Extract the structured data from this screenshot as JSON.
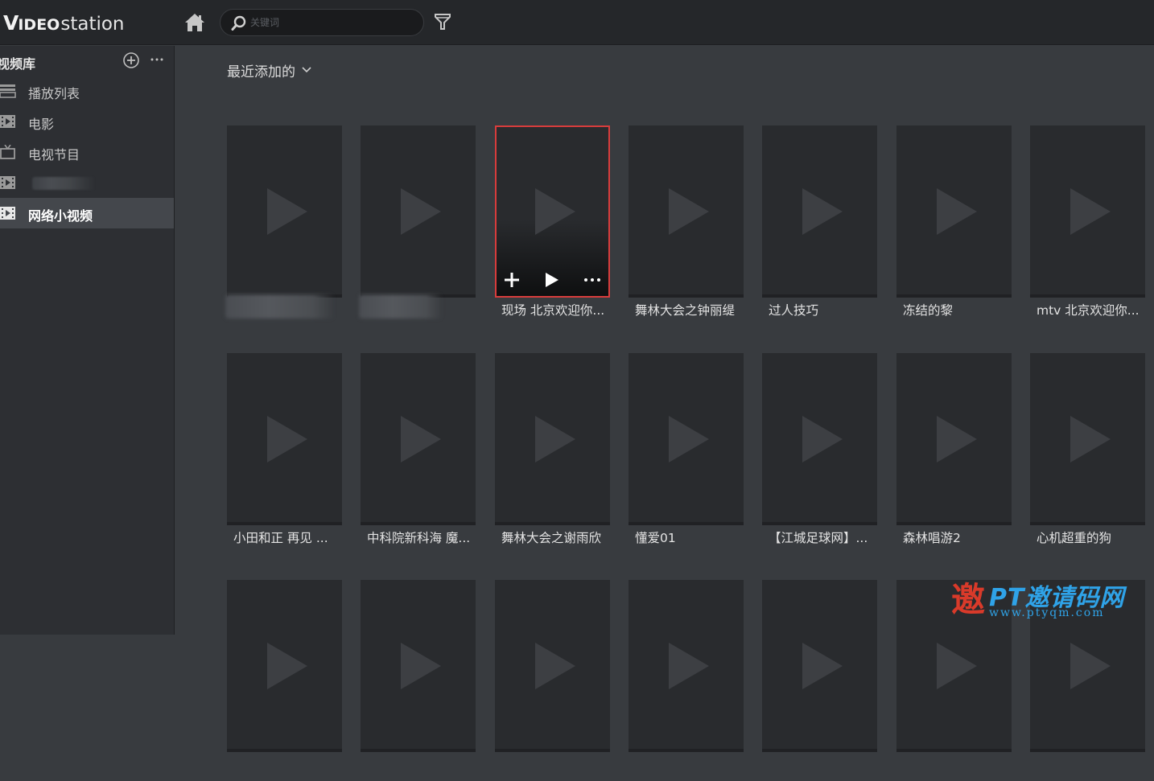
{
  "app": {
    "logo_v": "V",
    "logo_ideo": "IDEO",
    "logo_station": "station"
  },
  "header": {
    "search_placeholder": "关键词"
  },
  "sidebar": {
    "library_title": "视频库",
    "items": [
      {
        "label": "播放列表",
        "icon": "playlist-icon",
        "active": false
      },
      {
        "label": "电影",
        "icon": "film-icon",
        "active": false
      },
      {
        "label": "电视节目",
        "icon": "tv-icon",
        "active": false
      },
      {
        "label": "",
        "icon": "film-icon",
        "active": false,
        "blurred": true
      },
      {
        "label": "网络小视频",
        "icon": "film-icon",
        "active": true
      }
    ]
  },
  "main": {
    "sort_label": "最近添加的",
    "videos": [
      {
        "title": "",
        "blurred": true
      },
      {
        "title": "",
        "blurred": true
      },
      {
        "title": "现场 北京欢迎你...",
        "selected": true
      },
      {
        "title": "舞林大会之钟丽缇"
      },
      {
        "title": "过人技巧"
      },
      {
        "title": "冻结的黎"
      },
      {
        "title": "mtv 北京欢迎你..."
      },
      {
        "title": "小田和正 再见 ..."
      },
      {
        "title": "中科院新科海 魔..."
      },
      {
        "title": "舞林大会之谢雨欣"
      },
      {
        "title": "懂爱01"
      },
      {
        "title": "【江城足球网】..."
      },
      {
        "title": "森林唱游2"
      },
      {
        "title": "心机超重的狗"
      },
      {
        "title": ""
      },
      {
        "title": ""
      },
      {
        "title": ""
      },
      {
        "title": ""
      },
      {
        "title": ""
      },
      {
        "title": ""
      },
      {
        "title": ""
      }
    ]
  },
  "watermark": {
    "char": "邀",
    "text1": "PT邀请码网",
    "text2": "www.ptyqm.com"
  },
  "colors": {
    "selection_border": "#d83c3c",
    "watermark_blue": "#2fa3e8",
    "active_nav_bg": "#44474c"
  }
}
